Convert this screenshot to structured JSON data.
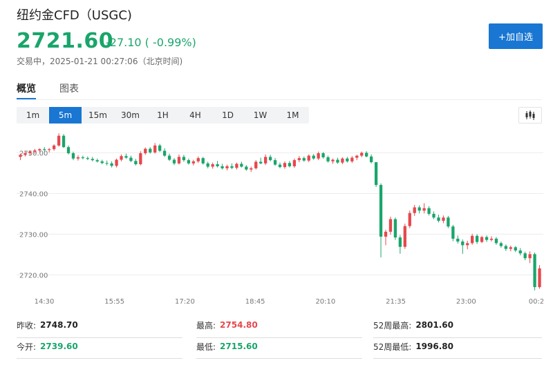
{
  "header": {
    "title": "纽约金CFD（USGC)",
    "price": "2721.60",
    "change": "-27.10 ( -0.99%)",
    "status": "交易中，2025-01-21 00:27:06（北京时间)",
    "add_button": "+加自选"
  },
  "tabs": [
    {
      "label": "概览",
      "active": true
    },
    {
      "label": "图表",
      "active": false
    }
  ],
  "periods": [
    {
      "label": "1m",
      "active": false
    },
    {
      "label": "5m",
      "active": true
    },
    {
      "label": "15m",
      "active": false
    },
    {
      "label": "30m",
      "active": false
    },
    {
      "label": "1H",
      "active": false
    },
    {
      "label": "4H",
      "active": false
    },
    {
      "label": "1D",
      "active": false
    },
    {
      "label": "1W",
      "active": false
    },
    {
      "label": "1M",
      "active": false
    }
  ],
  "chart_type_icon": "candlestick-icon",
  "colors": {
    "up": "#e5484d",
    "down": "#1aa56b",
    "accent": "#1976d2"
  },
  "chart_data": {
    "type": "candlestick",
    "ylim": [
      2716,
      2755
    ],
    "y_ticks": [
      "2740.00",
      "2730.00",
      "2720.00"
    ],
    "y_tick_values": [
      2740,
      2730,
      2720
    ],
    "top_tick_label": "2750.00",
    "top_tick_value": 2750,
    "x_ticks": [
      "14:30",
      "15:55",
      "17:20",
      "18:45",
      "20:10",
      "21:35",
      "23:00",
      "00:2"
    ],
    "grid": true,
    "candles": [
      [
        2749.0,
        2749.8,
        2748.2,
        2749.5
      ],
      [
        2749.5,
        2750.4,
        2749.1,
        2749.9
      ],
      [
        2749.9,
        2750.6,
        2749.3,
        2750.3
      ],
      [
        2750.3,
        2751.0,
        2749.8,
        2750.6
      ],
      [
        2750.6,
        2751.1,
        2750.2,
        2750.9
      ],
      [
        2750.9,
        2751.4,
        2750.3,
        2750.7
      ],
      [
        2750.7,
        2751.2,
        2750.1,
        2750.9
      ],
      [
        2750.9,
        2752.1,
        2750.5,
        2751.8
      ],
      [
        2751.8,
        2754.8,
        2751.5,
        2754.2
      ],
      [
        2754.2,
        2754.6,
        2751.2,
        2751.4
      ],
      [
        2751.4,
        2751.8,
        2749.6,
        2749.9
      ],
      [
        2749.9,
        2750.3,
        2748.2,
        2748.6
      ],
      [
        2748.6,
        2749.4,
        2748.1,
        2748.9
      ],
      [
        2748.9,
        2749.3,
        2748.4,
        2748.7
      ],
      [
        2748.7,
        2749.1,
        2748.2,
        2748.5
      ],
      [
        2748.5,
        2749.0,
        2747.9,
        2748.2
      ],
      [
        2748.2,
        2748.6,
        2747.6,
        2747.9
      ],
      [
        2747.9,
        2748.3,
        2747.2,
        2747.5
      ],
      [
        2747.5,
        2748.1,
        2746.9,
        2747.4
      ],
      [
        2747.4,
        2747.9,
        2746.4,
        2746.8
      ],
      [
        2746.8,
        2748.6,
        2746.4,
        2748.3
      ],
      [
        2748.3,
        2749.6,
        2747.9,
        2749.2
      ],
      [
        2749.2,
        2749.8,
        2748.5,
        2748.8
      ],
      [
        2748.8,
        2749.3,
        2747.7,
        2748.0
      ],
      [
        2748.0,
        2748.5,
        2746.9,
        2747.2
      ],
      [
        2747.2,
        2750.4,
        2746.9,
        2749.9
      ],
      [
        2749.9,
        2751.3,
        2749.5,
        2751.0
      ],
      [
        2751.0,
        2751.4,
        2749.8,
        2750.1
      ],
      [
        2750.1,
        2752.4,
        2749.8,
        2751.8
      ],
      [
        2751.8,
        2752.2,
        2750.2,
        2750.5
      ],
      [
        2750.5,
        2751.1,
        2749.0,
        2749.3
      ],
      [
        2749.3,
        2749.8,
        2748.0,
        2748.3
      ],
      [
        2748.3,
        2748.7,
        2747.0,
        2747.4
      ],
      [
        2747.4,
        2749.6,
        2747.1,
        2749.0
      ],
      [
        2749.0,
        2749.5,
        2747.8,
        2748.2
      ],
      [
        2748.2,
        2748.6,
        2747.1,
        2747.4
      ],
      [
        2747.4,
        2748.3,
        2746.9,
        2747.9
      ],
      [
        2747.9,
        2749.1,
        2747.5,
        2748.7
      ],
      [
        2748.7,
        2749.0,
        2747.1,
        2747.4
      ],
      [
        2747.4,
        2747.8,
        2746.2,
        2746.6
      ],
      [
        2746.6,
        2747.6,
        2746.1,
        2747.2
      ],
      [
        2747.2,
        2748.0,
        2746.4,
        2746.7
      ],
      [
        2746.7,
        2747.3,
        2745.9,
        2746.2
      ],
      [
        2746.2,
        2747.1,
        2745.7,
        2746.7
      ],
      [
        2746.7,
        2747.4,
        2746.0,
        2746.3
      ],
      [
        2746.3,
        2747.6,
        2745.9,
        2747.3
      ],
      [
        2747.3,
        2747.8,
        2746.4,
        2746.6
      ],
      [
        2746.6,
        2747.0,
        2745.6,
        2745.9
      ],
      [
        2745.9,
        2746.6,
        2745.3,
        2746.2
      ],
      [
        2746.2,
        2748.2,
        2745.9,
        2747.8
      ],
      [
        2747.8,
        2748.8,
        2747.2,
        2747.4
      ],
      [
        2747.4,
        2749.6,
        2747.0,
        2749.0
      ],
      [
        2749.0,
        2749.5,
        2747.9,
        2748.2
      ],
      [
        2748.2,
        2748.7,
        2746.8,
        2747.1
      ],
      [
        2747.1,
        2747.6,
        2746.2,
        2746.5
      ],
      [
        2746.5,
        2747.9,
        2746.1,
        2747.5
      ],
      [
        2747.5,
        2748.0,
        2746.4,
        2746.7
      ],
      [
        2746.7,
        2748.6,
        2746.3,
        2748.2
      ],
      [
        2748.2,
        2749.2,
        2747.7,
        2748.7
      ],
      [
        2748.7,
        2749.1,
        2747.8,
        2748.1
      ],
      [
        2748.1,
        2749.6,
        2747.7,
        2749.3
      ],
      [
        2749.3,
        2749.7,
        2748.3,
        2748.6
      ],
      [
        2748.6,
        2750.3,
        2748.2,
        2749.9
      ],
      [
        2749.9,
        2750.2,
        2748.6,
        2748.9
      ],
      [
        2748.9,
        2749.3,
        2747.6,
        2747.9
      ],
      [
        2747.9,
        2748.6,
        2747.3,
        2748.3
      ],
      [
        2748.3,
        2748.8,
        2747.3,
        2747.6
      ],
      [
        2747.6,
        2748.9,
        2747.2,
        2748.6
      ],
      [
        2748.6,
        2749.0,
        2747.6,
        2747.9
      ],
      [
        2747.9,
        2749.2,
        2747.5,
        2748.8
      ],
      [
        2748.8,
        2749.5,
        2748.2,
        2749.3
      ],
      [
        2749.3,
        2750.3,
        2748.9,
        2750.0
      ],
      [
        2750.0,
        2750.4,
        2748.9,
        2749.1
      ],
      [
        2749.1,
        2749.6,
        2747.4,
        2747.7
      ],
      [
        2747.7,
        2743.4,
        2741.6,
        2742.1
      ],
      [
        2742.1,
        2742.5,
        2724.3,
        2729.4
      ],
      [
        2729.4,
        2731.1,
        2727.3,
        2730.6
      ],
      [
        2730.6,
        2734.3,
        2729.9,
        2733.7
      ],
      [
        2733.7,
        2734.1,
        2728.6,
        2729.2
      ],
      [
        2729.2,
        2729.8,
        2725.2,
        2726.9
      ],
      [
        2726.9,
        2732.6,
        2726.4,
        2732.0
      ],
      [
        2732.0,
        2735.8,
        2731.5,
        2735.2
      ],
      [
        2735.2,
        2737.2,
        2734.5,
        2736.6
      ],
      [
        2736.6,
        2737.1,
        2735.1,
        2735.8
      ],
      [
        2735.8,
        2737.6,
        2735.1,
        2736.4
      ],
      [
        2736.4,
        2736.9,
        2734.6,
        2735.0
      ],
      [
        2735.0,
        2735.6,
        2733.7,
        2734.1
      ],
      [
        2734.1,
        2734.8,
        2732.9,
        2733.3
      ],
      [
        2733.3,
        2734.6,
        2732.7,
        2734.1
      ],
      [
        2734.1,
        2734.5,
        2731.5,
        2731.9
      ],
      [
        2731.9,
        2732.3,
        2728.3,
        2728.9
      ],
      [
        2728.9,
        2729.7,
        2727.7,
        2728.2
      ],
      [
        2728.2,
        2728.7,
        2725.2,
        2727.3
      ],
      [
        2727.3,
        2728.4,
        2726.3,
        2727.8
      ],
      [
        2727.8,
        2730.1,
        2727.4,
        2729.6
      ],
      [
        2729.6,
        2730.0,
        2727.6,
        2728.1
      ],
      [
        2728.1,
        2729.6,
        2727.8,
        2729.3
      ],
      [
        2729.3,
        2729.7,
        2728.1,
        2728.6
      ],
      [
        2728.6,
        2729.5,
        2728.2,
        2728.9
      ],
      [
        2728.9,
        2729.3,
        2727.4,
        2727.8
      ],
      [
        2727.8,
        2728.2,
        2726.7,
        2727.1
      ],
      [
        2727.1,
        2727.5,
        2725.9,
        2726.4
      ],
      [
        2726.4,
        2727.2,
        2725.8,
        2726.8
      ],
      [
        2726.8,
        2727.1,
        2725.6,
        2726.0
      ],
      [
        2726.0,
        2726.6,
        2724.8,
        2725.3
      ],
      [
        2725.3,
        2725.7,
        2723.6,
        2724.1
      ],
      [
        2724.1,
        2725.8,
        2722.9,
        2725.1
      ],
      [
        2725.1,
        2725.5,
        2716.2,
        2717.0
      ],
      [
        2717.0,
        2722.4,
        2716.6,
        2721.6
      ]
    ]
  },
  "stats": [
    {
      "label": "昨收:",
      "value": "2748.70",
      "tone": "plain"
    },
    {
      "label": "最高:",
      "value": "2754.80",
      "tone": "up"
    },
    {
      "label": "52周最高:",
      "value": "2801.60",
      "tone": "plain"
    },
    {
      "label": "今开:",
      "value": "2739.60",
      "tone": "down"
    },
    {
      "label": "最低:",
      "value": "2715.60",
      "tone": "down"
    },
    {
      "label": "52周最低:",
      "value": "1996.80",
      "tone": "plain"
    }
  ]
}
